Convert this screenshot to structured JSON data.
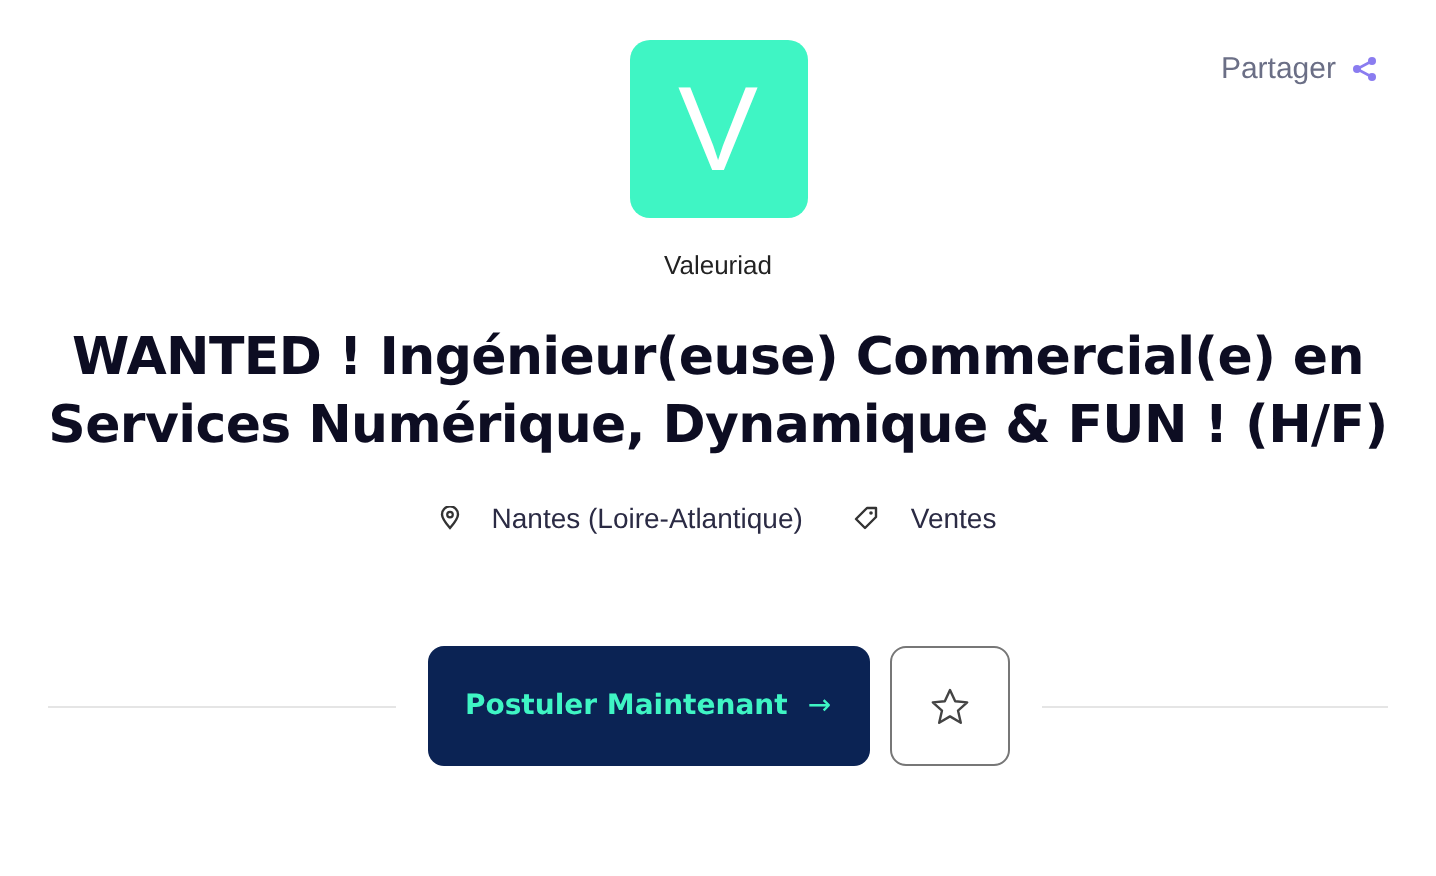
{
  "share": {
    "label": "Partager"
  },
  "company": {
    "logo_letter": "V",
    "name": "Valeuriad"
  },
  "title": "WANTED ! Ingénieur(euse) Commercial(e) en Services Numérique, Dynamique & FUN ! (H/F)",
  "meta": [
    {
      "kind": "location",
      "text": "Nantes (Loire-Atlantique)"
    },
    {
      "kind": "category",
      "text": "Ventes"
    }
  ],
  "apply_button": {
    "label": "Postuler Maintenant",
    "arrow": "→"
  }
}
